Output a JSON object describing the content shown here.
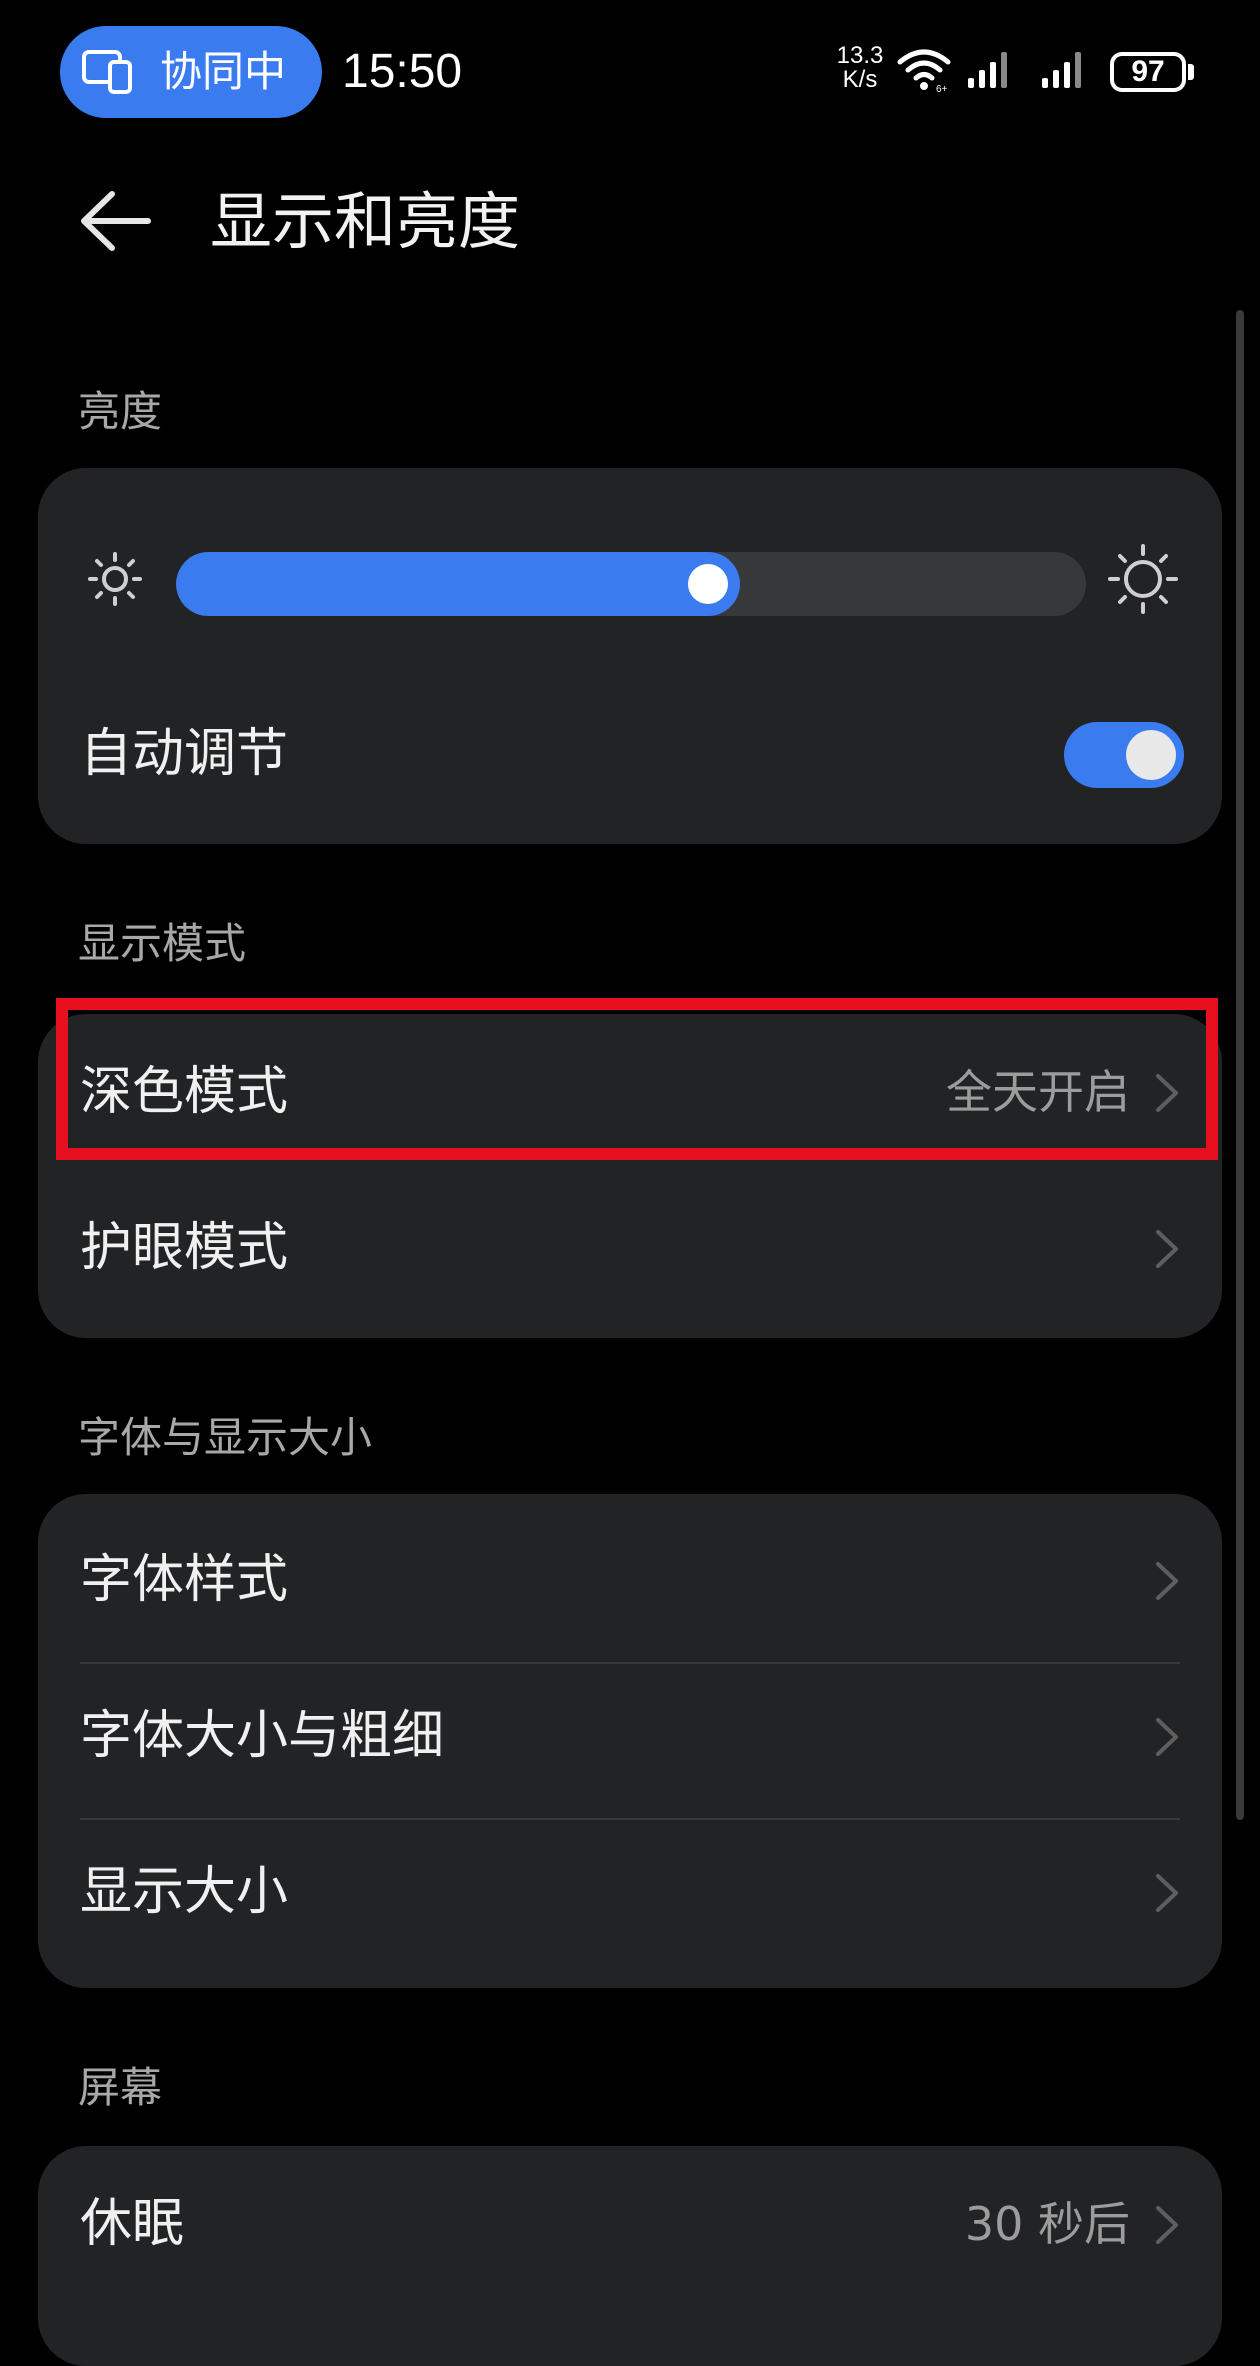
{
  "status_bar": {
    "collab_label": "协同中",
    "time": "15:50",
    "net_speed_value": "13.3",
    "net_speed_unit": "K/s",
    "battery": "97"
  },
  "header": {
    "title": "显示和亮度"
  },
  "brightness": {
    "section_title": "亮度",
    "level": 0.62,
    "auto_adjust_label": "自动调节",
    "auto_adjust_on": true
  },
  "display_mode": {
    "section_title": "显示模式",
    "dark_mode_label": "深色模式",
    "dark_mode_value": "全天开启",
    "eye_comfort_label": "护眼模式"
  },
  "font_and_size": {
    "section_title": "字体与显示大小",
    "font_style_label": "字体样式",
    "font_size_weight_label": "字体大小与粗细",
    "display_size_label": "显示大小"
  },
  "screen": {
    "section_title": "屏幕",
    "sleep_label": "休眠",
    "sleep_value": "30 秒后"
  },
  "colors": {
    "accent": "#3a7cf0",
    "highlight": "#e8101e",
    "card_bg": "#222325",
    "background": "#000000"
  }
}
